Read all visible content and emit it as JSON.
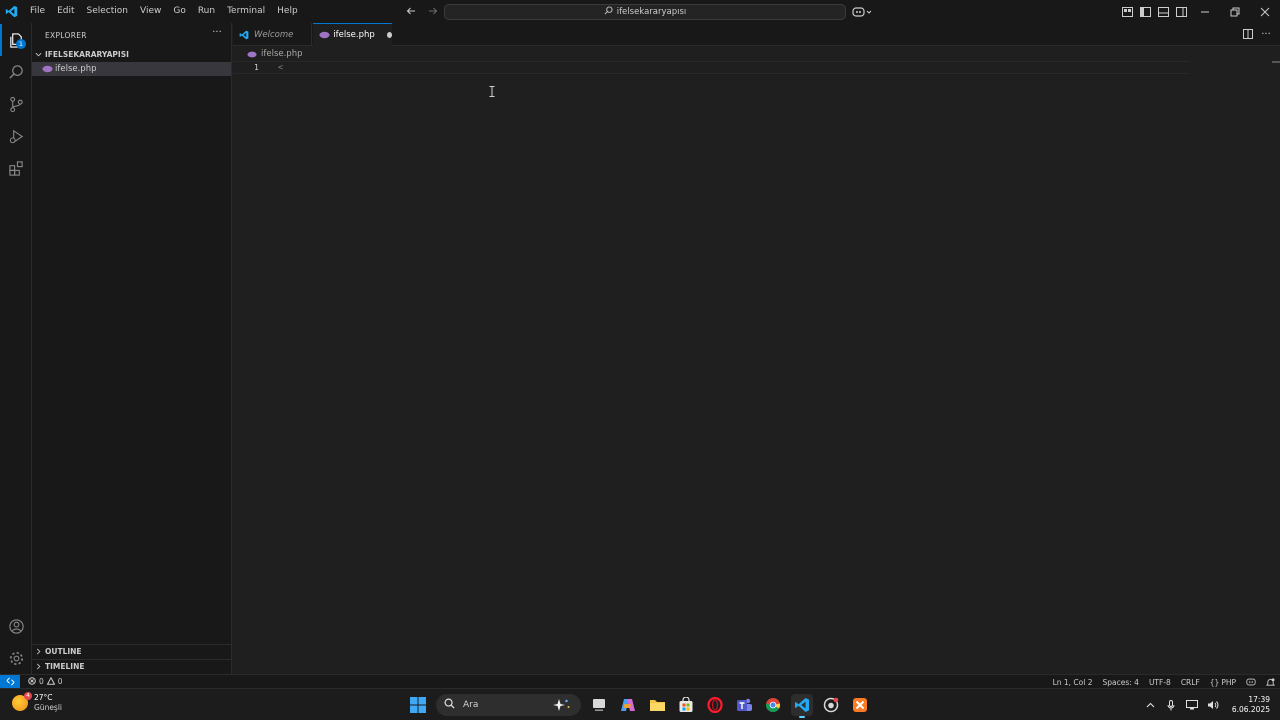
{
  "titlebar": {
    "menu": [
      "File",
      "Edit",
      "Selection",
      "View",
      "Go",
      "Run",
      "Terminal",
      "Help"
    ],
    "search_text": "ifelsekararyapısı"
  },
  "activitybar": {
    "explorer_badge": "1"
  },
  "sidebar": {
    "title": "EXPLORER",
    "more": "···",
    "folder": "IFELSEKARARYAPISI",
    "files": [
      {
        "name": "ifelse.php"
      }
    ],
    "outline": "OUTLINE",
    "timeline": "TIMELINE"
  },
  "tabs": [
    {
      "label": "Welcome"
    },
    {
      "label": "ifelse.php",
      "dirty": true
    }
  ],
  "breadcrumb": "ifelse.php",
  "editor": {
    "lines": [
      {
        "number": "1",
        "text": "<"
      }
    ]
  },
  "statusbar": {
    "errors": "0",
    "warnings": "0",
    "position": "Ln 1, Col 2",
    "spaces": "Spaces: 4",
    "encoding": "UTF-8",
    "eol": "CRLF",
    "language": "PHP"
  },
  "taskbar": {
    "badge": "4",
    "temperature": "27°C",
    "condition": "Güneşli",
    "search_placeholder": "Ara",
    "time": "17:39",
    "date": "6.06.2025"
  },
  "colors": {
    "accent": "#0078d4",
    "editor_bg": "#1f1f1f",
    "chrome_bg": "#181818",
    "php_icon": "#a074c4"
  }
}
